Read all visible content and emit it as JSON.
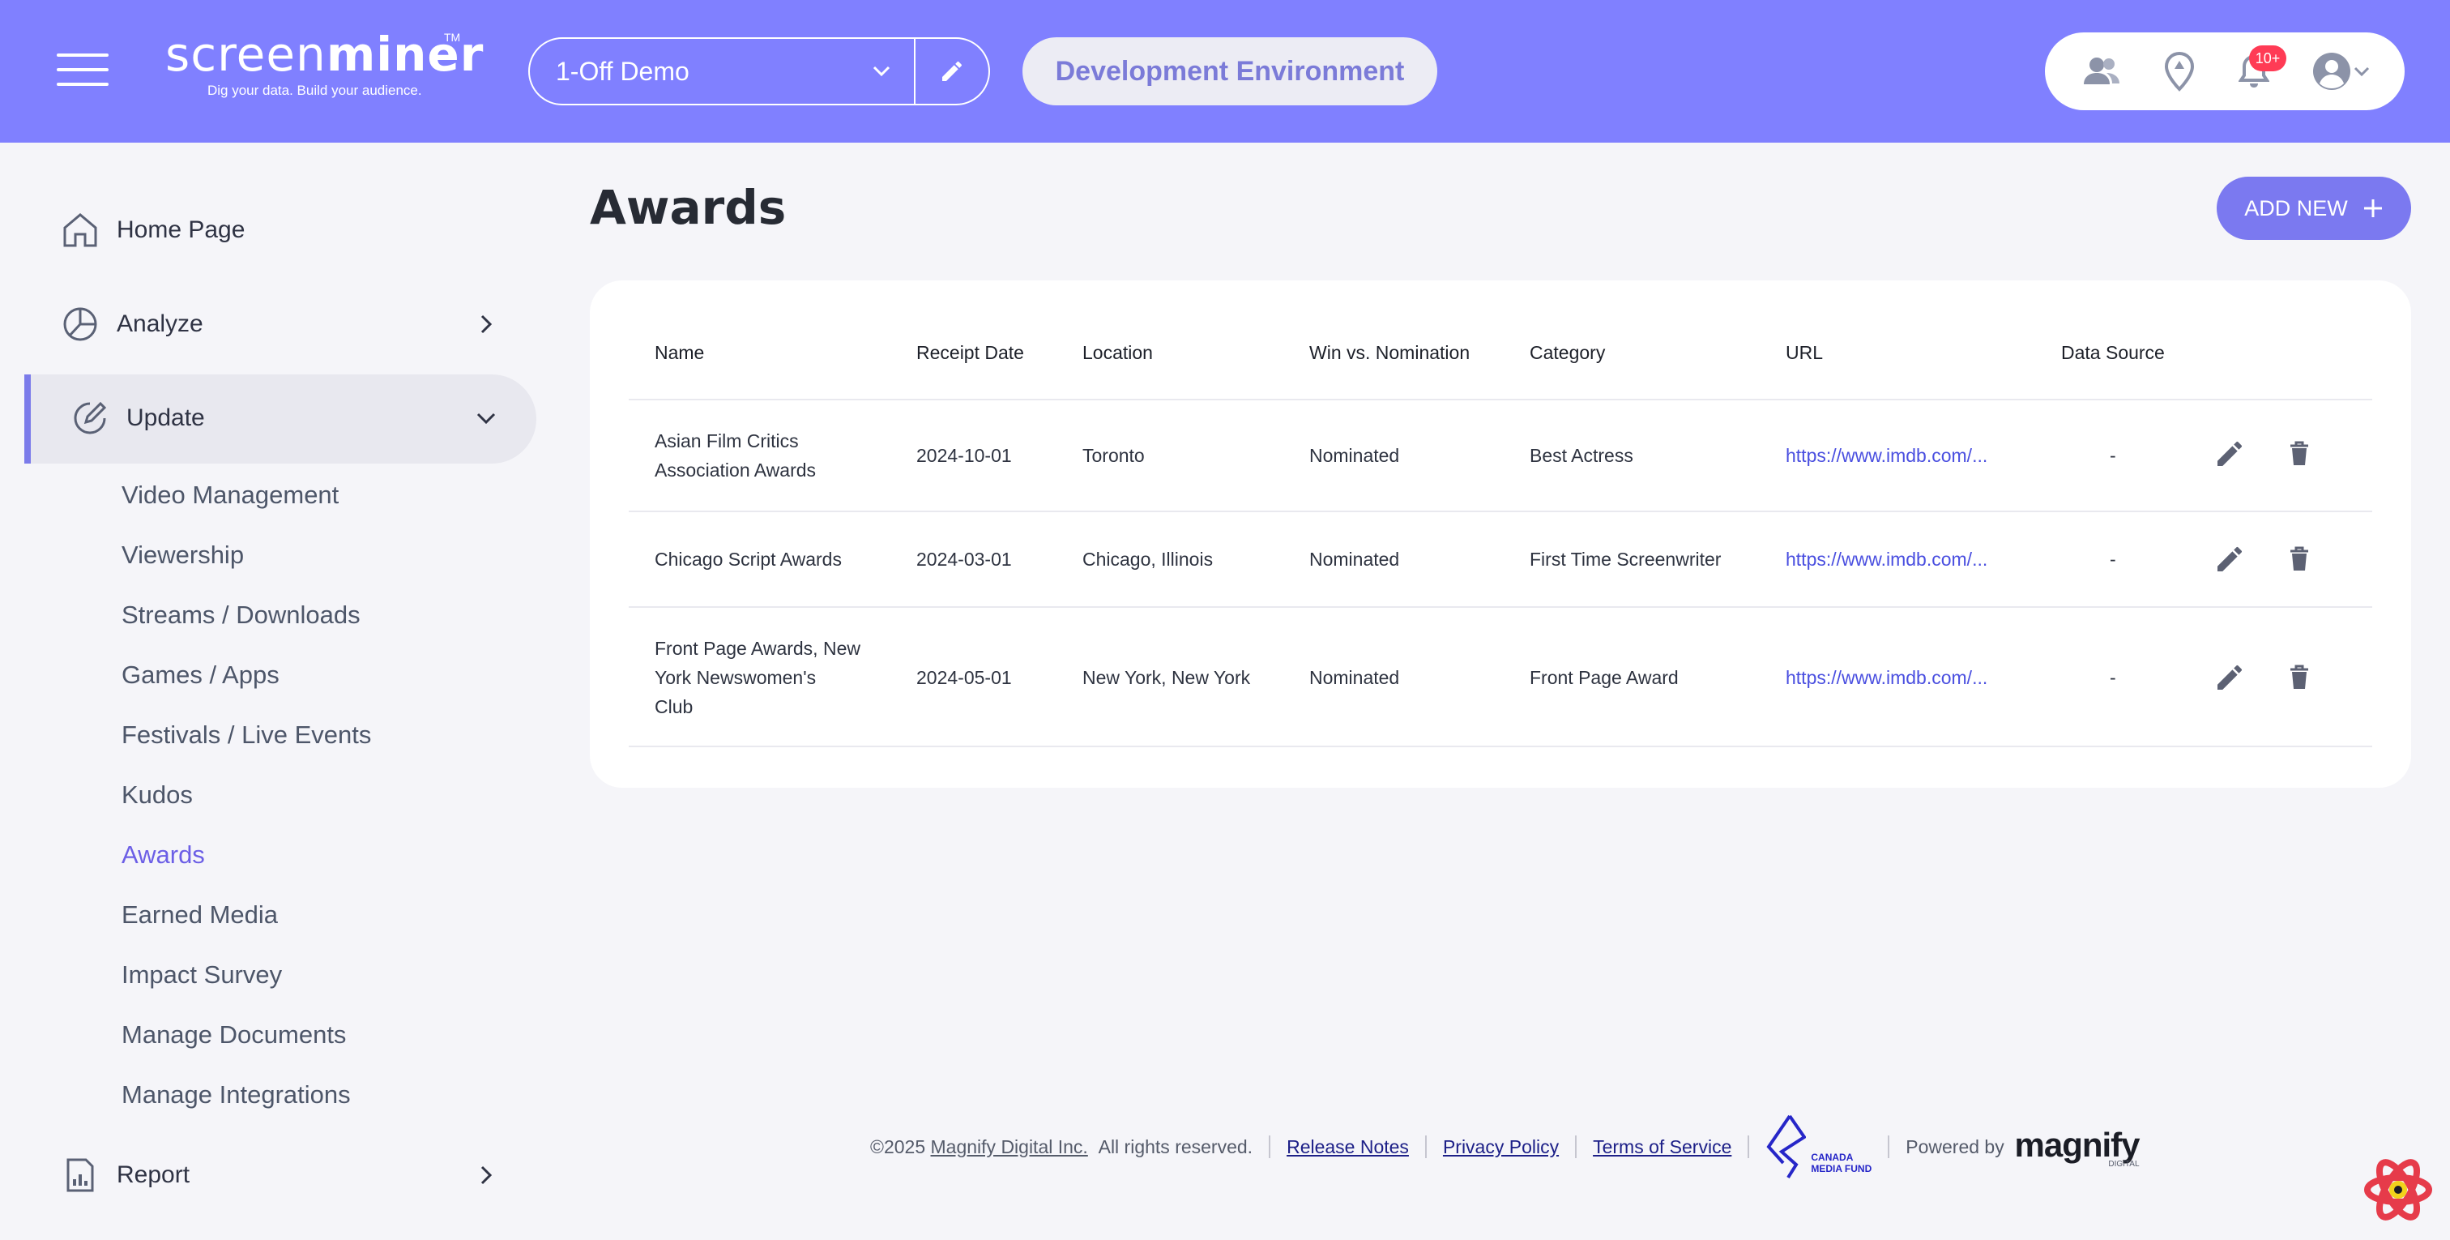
{
  "header": {
    "logo_light": "screen",
    "logo_bold": "miner",
    "logo_tm": "TM",
    "tagline": "Dig your data. Build your audience.",
    "project_select": "1-Off Demo",
    "environment": "Development Environment",
    "notification_count": "10+",
    "accent_color": "#8080ff"
  },
  "sidebar": {
    "home": "Home Page",
    "analyze": "Analyze",
    "update": "Update",
    "report": "Report",
    "sub_items": [
      "Video Management",
      "Viewership",
      "Streams / Downloads",
      "Games / Apps",
      "Festivals / Live Events",
      "Kudos",
      "Awards",
      "Earned Media",
      "Impact Survey",
      "Manage Documents",
      "Manage Integrations"
    ],
    "active_sub_item": "Awards"
  },
  "main": {
    "title": "Awards",
    "add_button": "ADD NEW",
    "table": {
      "headers": [
        "Name",
        "Receipt Date",
        "Location",
        "Win vs. Nomination",
        "Category",
        "URL",
        "Data Source"
      ],
      "rows": [
        {
          "name_lines": [
            "Asian Film Critics",
            "Association Awards"
          ],
          "receipt_date": "2024-10-01",
          "location": "Toronto",
          "win_vs_nomination": "Nominated",
          "category": "Best Actress",
          "url": "https://www.imdb.com/...",
          "data_source": "-"
        },
        {
          "name_lines": [
            "Chicago Script Awards"
          ],
          "receipt_date": "2024-03-01",
          "location": "Chicago, Illinois",
          "win_vs_nomination": "Nominated",
          "category": "First Time Screenwriter",
          "url": "https://www.imdb.com/...",
          "data_source": "-"
        },
        {
          "name_lines": [
            "Front Page Awards, New",
            "York Newswomen's",
            "Club"
          ],
          "receipt_date": "2024-05-01",
          "location": "New York, New York",
          "win_vs_nomination": "Nominated",
          "category": "Front Page Award",
          "url": "https://www.imdb.com/...",
          "data_source": "-"
        }
      ]
    }
  },
  "footer": {
    "copyright": "©2025",
    "company": "Magnify Digital Inc.",
    "rights": "All rights reserved.",
    "release_notes": "Release Notes",
    "privacy": "Privacy Policy",
    "terms": "Terms of Service",
    "cmf_line1": "CANADA",
    "cmf_line2": "MEDIA FUND",
    "powered_by": "Powered by",
    "brand": "magnify",
    "brand_sub": "DIGITAL"
  }
}
